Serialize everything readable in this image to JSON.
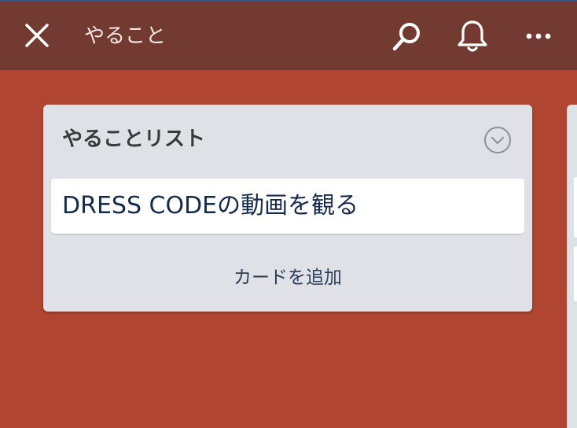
{
  "header": {
    "title": "やること",
    "icons": {
      "close": "close-icon",
      "search": "search-icon",
      "notifications": "bell-icon",
      "more": "more-icon"
    }
  },
  "board": {
    "background_color": "#b04632",
    "header_color": "#723a31",
    "lists": [
      {
        "title": "やることリスト",
        "menu_icon": "chevron-down-circle-icon",
        "cards": [
          {
            "title": "DRESS CODEの動画を観る"
          }
        ],
        "add_card_label": "カードを追加"
      }
    ]
  }
}
